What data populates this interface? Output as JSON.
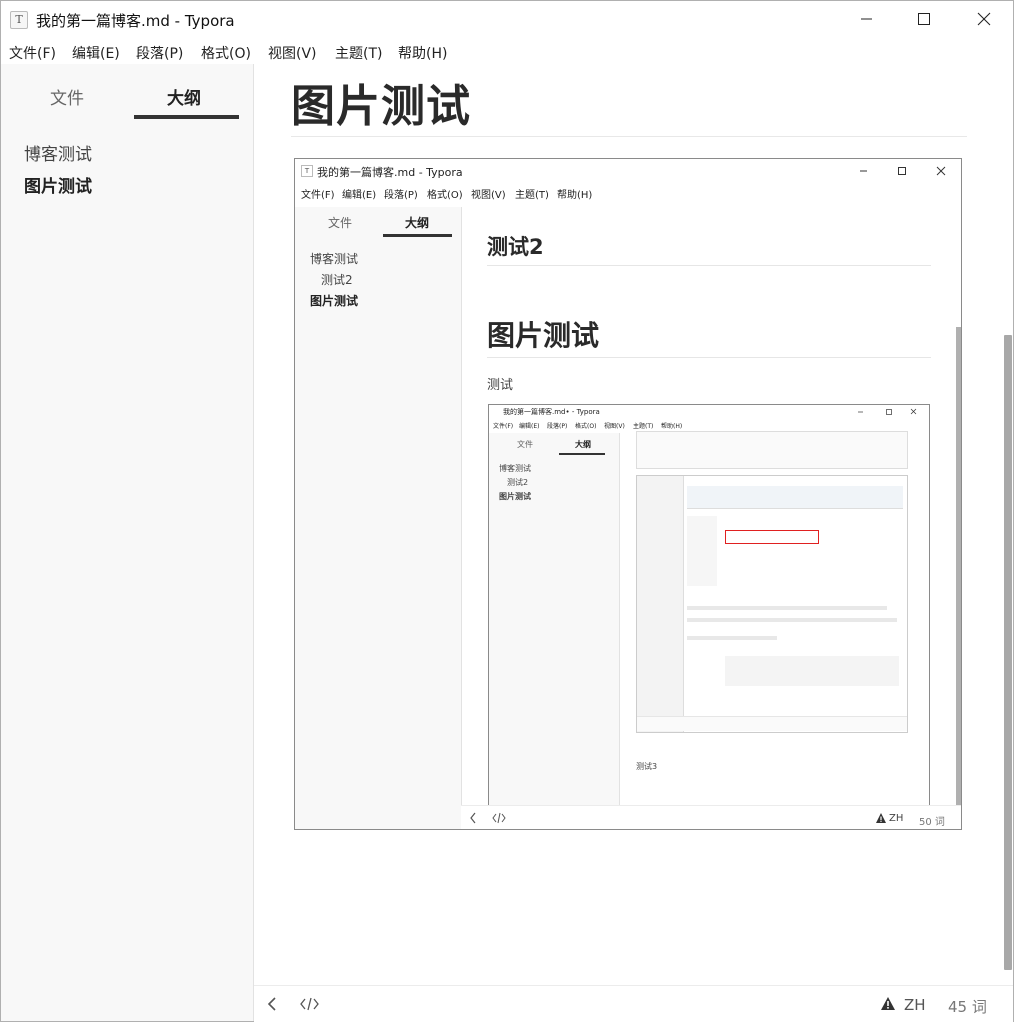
{
  "window": {
    "title": "我的第一篇博客.md - Typora",
    "icon": "T"
  },
  "menu": [
    "文件(F)",
    "编辑(E)",
    "段落(P)",
    "格式(O)",
    "视图(V)",
    "主题(T)",
    "帮助(H)"
  ],
  "sidebar": {
    "tabs": [
      "文件",
      "大纲"
    ],
    "active_tab": "大纲",
    "outline": [
      "博客测试",
      "图片测试"
    ],
    "active_outline": "图片测试"
  },
  "document": {
    "heading": "图片测试"
  },
  "embedded": {
    "window_title": "我的第一篇博客.md - Typora",
    "menu": [
      "文件(F)",
      "编辑(E)",
      "段落(P)",
      "格式(O)",
      "视图(V)",
      "主题(T)",
      "帮助(H)"
    ],
    "tabs": [
      "文件",
      "大纲"
    ],
    "outline": [
      "博客测试",
      "测试2",
      "图片测试"
    ],
    "heading2": "测试2",
    "heading1": "图片测试",
    "paragraph": "测试",
    "status": {
      "lang": "ZH",
      "words": "50 词"
    },
    "inner": {
      "window_title": "我的第一篇博客.md• - Typora",
      "menu": [
        "文件(F)",
        "编辑(E)",
        "段落(P)",
        "格式(O)",
        "视图(V)",
        "主题(T)",
        "帮助(H)"
      ],
      "tabs": [
        "文件",
        "大纲"
      ],
      "outline": [
        "博客测试",
        "测试2",
        "图片测试"
      ],
      "paragraph": "测试3"
    }
  },
  "statusbar": {
    "lang": "ZH",
    "words": "45 词"
  },
  "colors": {
    "sidebar_bg": "#f8f8f8",
    "accent": "#333333",
    "scrollbar": "#a8a8a8"
  }
}
